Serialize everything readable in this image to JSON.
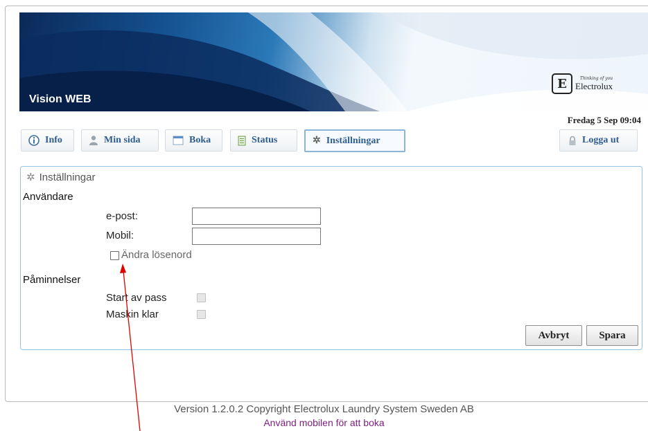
{
  "header": {
    "app_title": "Vision WEB",
    "brand_tagline": "Thinking of you",
    "brand_name": "Electrolux",
    "datetime": "Fredag 5 Sep 09:04"
  },
  "nav": {
    "info": {
      "label": "Info",
      "icon": "info-icon"
    },
    "min_sida": {
      "label": "Min sida",
      "icon": "user-icon"
    },
    "boka": {
      "label": "Boka",
      "icon": "calendar-icon"
    },
    "status": {
      "label": "Status",
      "icon": "status-icon"
    },
    "installningar": {
      "label": "Inställningar",
      "icon": "gear-icon",
      "active": true
    },
    "logout": {
      "label": "Logga ut",
      "icon": "lock-icon"
    }
  },
  "settings": {
    "title": "Inställningar",
    "user_section": "Användare",
    "email_label": "e-post:",
    "email_value": "",
    "mobile_label": "Mobil:",
    "mobile_value": "",
    "change_password_label": "Ändra lösenord",
    "change_password_checked": false,
    "reminders_section": "Påminnelser",
    "start_label": "Start av pass",
    "machine_done_label": "Maskin klar",
    "cancel_label": "Avbryt",
    "save_label": "Spara"
  },
  "footer": {
    "version": "Version 1.2.0.2 Copyright Electrolux Laundry System Sweden AB",
    "mobile_link": "Använd mobilen för att boka"
  },
  "colors": {
    "nav_text": "#2d5d8f",
    "panel_border": "#94c3e6",
    "link": "#7a1f7d",
    "annotation_arrow": "#e00000"
  }
}
